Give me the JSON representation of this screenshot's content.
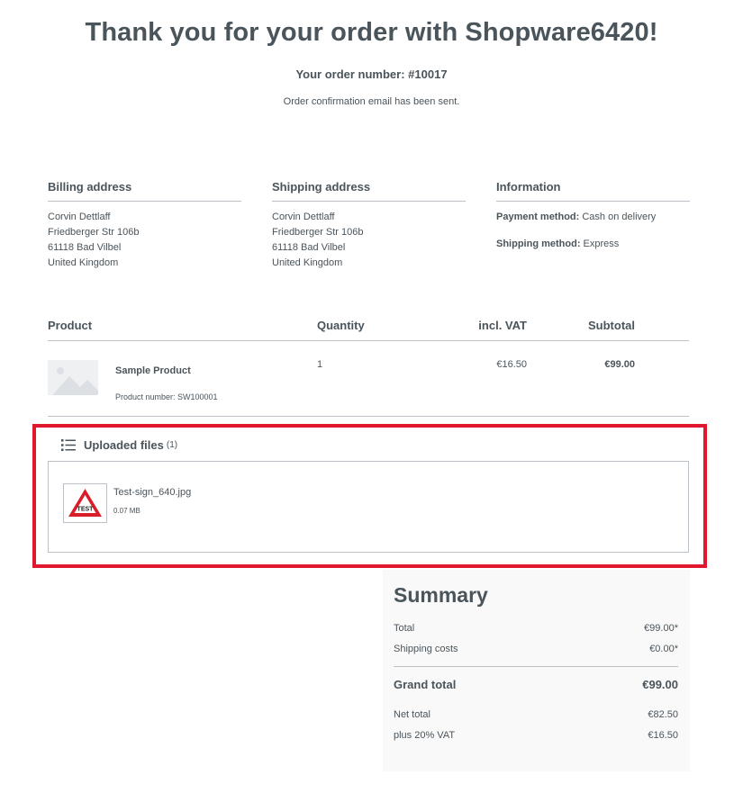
{
  "header": {
    "title": "Thank you for your order with Shopware6420!",
    "order_number": "Your order number: #10017",
    "confirmation": "Order confirmation email has been sent."
  },
  "billing": {
    "title": "Billing address",
    "name": "Corvin Dettlaff",
    "street": "Friedberger Str 106b",
    "city": "61118 Bad Vilbel",
    "country": "United Kingdom"
  },
  "shipping": {
    "title": "Shipping address",
    "name": "Corvin Dettlaff",
    "street": "Friedberger Str 106b",
    "city": "61118 Bad Vilbel",
    "country": "United Kingdom"
  },
  "information": {
    "title": "Information",
    "payment_label": "Payment method:",
    "payment_value": "Cash on delivery",
    "shipping_label": "Shipping method:",
    "shipping_value": "Express"
  },
  "table": {
    "headers": {
      "product": "Product",
      "quantity": "Quantity",
      "vat": "incl. VAT",
      "subtotal": "Subtotal"
    },
    "items": [
      {
        "name": "Sample Product",
        "number": "Product number: SW100001",
        "quantity": "1",
        "vat": "€16.50",
        "subtotal": "€99.00",
        "image": "placeholder-image-icon"
      }
    ]
  },
  "uploads": {
    "title": "Uploaded files",
    "count": "(1)",
    "files": [
      {
        "name": "Test-sign_640.jpg",
        "size": "0.07 MB",
        "thumb_text": "TEST"
      }
    ]
  },
  "summary": {
    "title": "Summary",
    "total_label": "Total",
    "total_value": "€99.00*",
    "shipping_label": "Shipping costs",
    "shipping_value": "€0.00*",
    "grand_label": "Grand total",
    "grand_value": "€99.00",
    "net_label": "Net total",
    "net_value": "€82.50",
    "vat_label": "plus 20% VAT",
    "vat_value": "€16.50"
  },
  "colors": {
    "text": "#4a545b",
    "border": "#bcc1c7",
    "highlight": "#e0182d",
    "summary_bg": "#f9f9f9"
  }
}
